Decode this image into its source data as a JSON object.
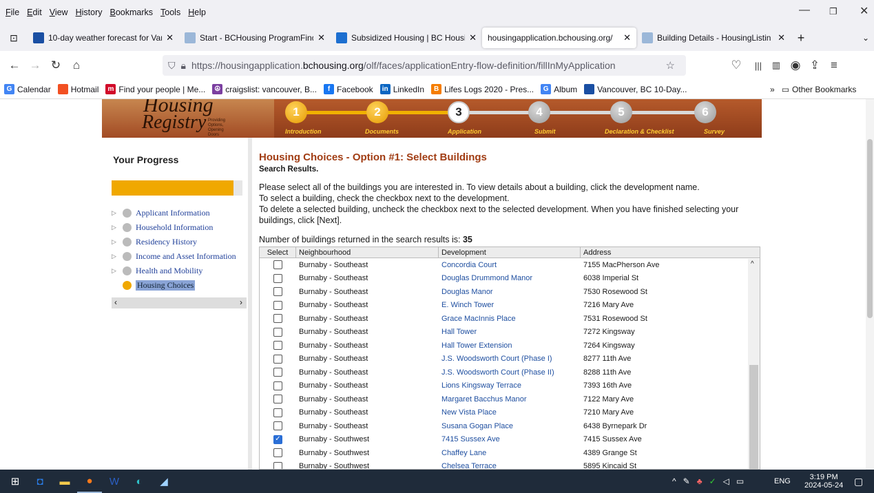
{
  "menu": [
    "File",
    "Edit",
    "View",
    "History",
    "Bookmarks",
    "Tools",
    "Help"
  ],
  "tabs": [
    {
      "title": "10-day weather forecast for Van",
      "color": "#1a4fa3"
    },
    {
      "title": "Start - BCHousing ProgramFind",
      "color": "#9bb7d8"
    },
    {
      "title": "Subsidized Housing | BC Housin",
      "color": "#1d6fd0"
    },
    {
      "title": "housingapplication.bchousing.org/",
      "color": "#ffffff"
    },
    {
      "title": "Building Details - HousingListin",
      "color": "#9bb7d8"
    }
  ],
  "url": {
    "pre": "https://housingapplication.",
    "domain": "bchousing.org",
    "post": "/olf/faces/applicationEntry-flow-definition/fillInMyApplication"
  },
  "bookmarks": [
    {
      "label": "Calendar",
      "icon": "G",
      "color": "#4285f4"
    },
    {
      "label": "Hotmail",
      "icon": "",
      "color": "#f25022"
    },
    {
      "label": "Find your people | Me...",
      "icon": "m",
      "color": "#d10a2a"
    },
    {
      "label": "craigslist: vancouver, B...",
      "icon": "☮",
      "color": "#7b3fa0"
    },
    {
      "label": "Facebook",
      "icon": "f",
      "color": "#1877f2"
    },
    {
      "label": "LinkedIn",
      "icon": "in",
      "color": "#0a66c2"
    },
    {
      "label": "Lifes Logs 2020 - Pres...",
      "icon": "B",
      "color": "#f57d00"
    },
    {
      "label": "Album",
      "icon": "G",
      "color": "#4285f4"
    },
    {
      "label": "Vancouver, BC 10-Day...",
      "icon": "",
      "color": "#1a4fa3"
    }
  ],
  "other_bookmarks": "Other Bookmarks",
  "banner": {
    "logo1": "Housing",
    "logo2": "Registry",
    "tagline": "Providing Options, Opening Doors",
    "steps": [
      {
        "n": "1",
        "label": "Introduction",
        "state": "done"
      },
      {
        "n": "2",
        "label": "Documents",
        "state": "done"
      },
      {
        "n": "3",
        "label": "Application",
        "state": "cur"
      },
      {
        "n": "4",
        "label": "Submit",
        "state": "todo"
      },
      {
        "n": "5",
        "label": "Declaration & Checklist",
        "state": "todo"
      },
      {
        "n": "6",
        "label": "Survey",
        "state": "todo"
      }
    ]
  },
  "sidebar": {
    "title": "Your Progress",
    "progress": 0.93,
    "items": [
      {
        "label": "Applicant Information",
        "current": false
      },
      {
        "label": "Household Information",
        "current": false
      },
      {
        "label": "Residency History",
        "current": false
      },
      {
        "label": "Income and Asset Information",
        "current": false
      },
      {
        "label": "Health and Mobility",
        "current": false
      },
      {
        "label": "Housing Choices",
        "current": true
      }
    ]
  },
  "main": {
    "title": "Housing Choices - Option #1: Select Buildings",
    "subtitle": "Search Results.",
    "instructions": [
      "Please select all of the buildings you are interested in. To view details about a building, click the development name.",
      "To select a building, check the checkbox next to the development.",
      "To delete a selected building, uncheck the checkbox next to the selected development. When you have finished selecting your buildings, click [Next]."
    ],
    "count_label": "Number of buildings returned in the search results is: ",
    "count": "35",
    "headers": [
      "Select",
      "Neighbourhood",
      "Development",
      "Address"
    ],
    "rows": [
      {
        "n": "Burnaby - Southeast",
        "d": "Concordia Court",
        "a": "7155 MacPherson Ave",
        "c": false
      },
      {
        "n": "Burnaby - Southeast",
        "d": "Douglas Drummond Manor",
        "a": "6038 Imperial St",
        "c": false
      },
      {
        "n": "Burnaby - Southeast",
        "d": "Douglas Manor",
        "a": "7530 Rosewood St",
        "c": false
      },
      {
        "n": "Burnaby - Southeast",
        "d": "E. Winch Tower",
        "a": "7216 Mary Ave",
        "c": false
      },
      {
        "n": "Burnaby - Southeast",
        "d": "Grace MacInnis Place",
        "a": "7531 Rosewood St",
        "c": false
      },
      {
        "n": "Burnaby - Southeast",
        "d": "Hall Tower",
        "a": "7272 Kingsway",
        "c": false
      },
      {
        "n": "Burnaby - Southeast",
        "d": "Hall Tower Extension",
        "a": "7264 Kingsway",
        "c": false
      },
      {
        "n": "Burnaby - Southeast",
        "d": "J.S. Woodsworth Court (Phase I)",
        "a": "8277 11th Ave",
        "c": false
      },
      {
        "n": "Burnaby - Southeast",
        "d": "J.S. Woodsworth Court (Phase II)",
        "a": "8288 11th Ave",
        "c": false
      },
      {
        "n": "Burnaby - Southeast",
        "d": "Lions Kingsway Terrace",
        "a": "7393 16th Ave",
        "c": false
      },
      {
        "n": "Burnaby - Southeast",
        "d": "Margaret Bacchus Manor",
        "a": "7122 Mary Ave",
        "c": false
      },
      {
        "n": "Burnaby - Southeast",
        "d": "New Vista Place",
        "a": "7210 Mary Ave",
        "c": false
      },
      {
        "n": "Burnaby - Southeast",
        "d": "Susana Gogan Place",
        "a": "6438 Byrnepark Dr",
        "c": false
      },
      {
        "n": "Burnaby - Southwest",
        "d": "7415 Sussex Ave",
        "a": "7415 Sussex Ave",
        "c": true
      },
      {
        "n": "Burnaby - Southwest",
        "d": "Chaffey Lane",
        "a": "4389 Grange St",
        "c": false
      },
      {
        "n": "Burnaby - Southwest",
        "d": "Chelsea Terrace",
        "a": "5895 Kincaid St",
        "c": false
      }
    ]
  },
  "tray": {
    "lang": "ENG",
    "time": "3:19 PM",
    "date": "2024-05-24"
  }
}
